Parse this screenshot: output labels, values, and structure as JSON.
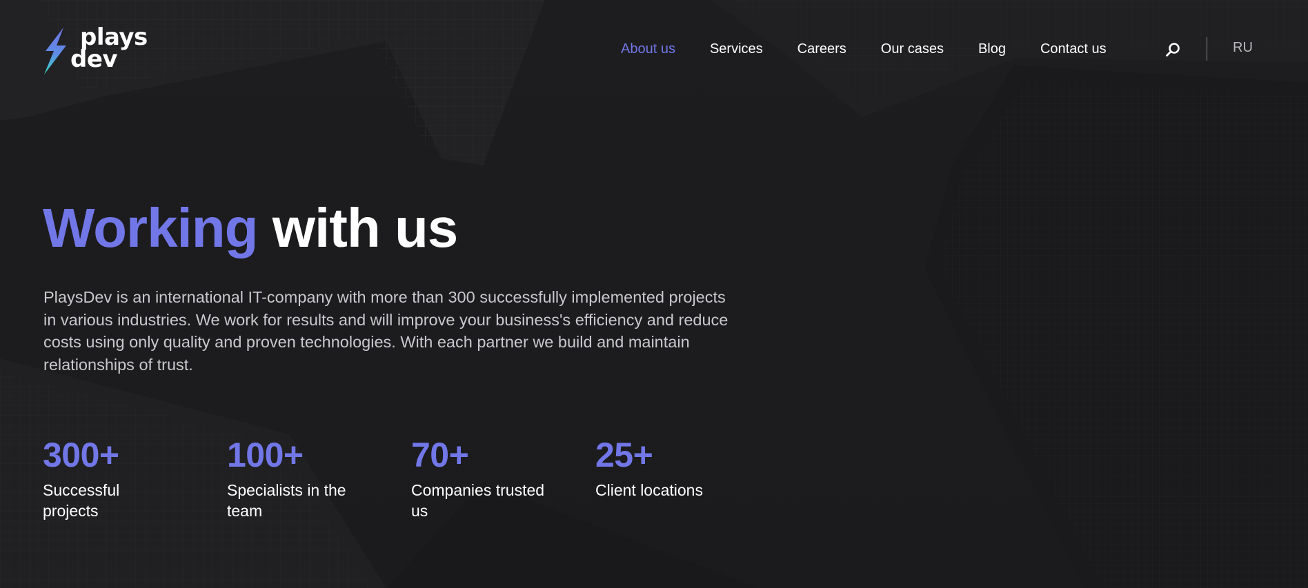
{
  "brand": {
    "logo_line1": "plays",
    "logo_line2": "dev",
    "accent_color": "#7277e8",
    "bolt_gradient": [
      "#7277e8",
      "#39d9c4"
    ]
  },
  "nav": {
    "items": [
      {
        "label": "About us",
        "active": true
      },
      {
        "label": "Services",
        "active": false
      },
      {
        "label": "Careers",
        "active": false
      },
      {
        "label": "Our cases",
        "active": false
      },
      {
        "label": "Blog",
        "active": false
      },
      {
        "label": "Contact us",
        "active": false
      }
    ],
    "search_icon": "search-icon",
    "language": "RU"
  },
  "hero": {
    "title_accent": "Working",
    "title_rest": "with us",
    "description": "PlaysDev is an international IT-company with more than 300 successfully implemented projects in various industries. We work for results and will improve your business's efficiency and reduce costs using only quality and proven technologies. With each partner we build and maintain relationships of trust."
  },
  "stats": [
    {
      "value": "300+",
      "label": "Successful projects"
    },
    {
      "value": "100+",
      "label": "Specialists in the team"
    },
    {
      "value": "70+",
      "label": "Companies trusted us"
    },
    {
      "value": "25+",
      "label": "Client locations"
    }
  ],
  "colors": {
    "background": "#1c1c1e",
    "text": "#ffffff",
    "muted_text": "#c9c9cd"
  }
}
